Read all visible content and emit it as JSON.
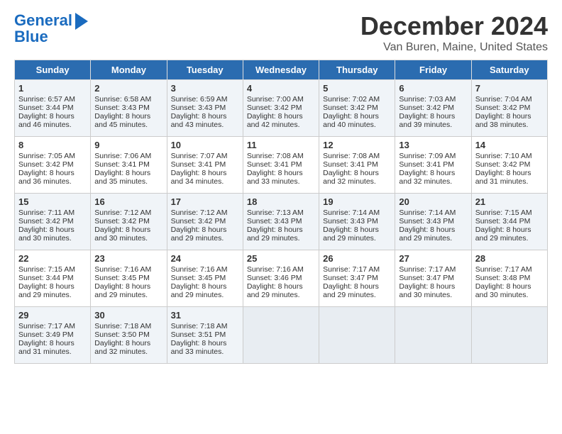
{
  "logo": {
    "line1": "General",
    "line2": "Blue"
  },
  "title": "December 2024",
  "location": "Van Buren, Maine, United States",
  "headers": [
    "Sunday",
    "Monday",
    "Tuesday",
    "Wednesday",
    "Thursday",
    "Friday",
    "Saturday"
  ],
  "weeks": [
    [
      {
        "day": "1",
        "sunrise": "Sunrise: 6:57 AM",
        "sunset": "Sunset: 3:44 PM",
        "daylight": "Daylight: 8 hours and 46 minutes."
      },
      {
        "day": "2",
        "sunrise": "Sunrise: 6:58 AM",
        "sunset": "Sunset: 3:43 PM",
        "daylight": "Daylight: 8 hours and 45 minutes."
      },
      {
        "day": "3",
        "sunrise": "Sunrise: 6:59 AM",
        "sunset": "Sunset: 3:43 PM",
        "daylight": "Daylight: 8 hours and 43 minutes."
      },
      {
        "day": "4",
        "sunrise": "Sunrise: 7:00 AM",
        "sunset": "Sunset: 3:42 PM",
        "daylight": "Daylight: 8 hours and 42 minutes."
      },
      {
        "day": "5",
        "sunrise": "Sunrise: 7:02 AM",
        "sunset": "Sunset: 3:42 PM",
        "daylight": "Daylight: 8 hours and 40 minutes."
      },
      {
        "day": "6",
        "sunrise": "Sunrise: 7:03 AM",
        "sunset": "Sunset: 3:42 PM",
        "daylight": "Daylight: 8 hours and 39 minutes."
      },
      {
        "day": "7",
        "sunrise": "Sunrise: 7:04 AM",
        "sunset": "Sunset: 3:42 PM",
        "daylight": "Daylight: 8 hours and 38 minutes."
      }
    ],
    [
      {
        "day": "8",
        "sunrise": "Sunrise: 7:05 AM",
        "sunset": "Sunset: 3:42 PM",
        "daylight": "Daylight: 8 hours and 36 minutes."
      },
      {
        "day": "9",
        "sunrise": "Sunrise: 7:06 AM",
        "sunset": "Sunset: 3:41 PM",
        "daylight": "Daylight: 8 hours and 35 minutes."
      },
      {
        "day": "10",
        "sunrise": "Sunrise: 7:07 AM",
        "sunset": "Sunset: 3:41 PM",
        "daylight": "Daylight: 8 hours and 34 minutes."
      },
      {
        "day": "11",
        "sunrise": "Sunrise: 7:08 AM",
        "sunset": "Sunset: 3:41 PM",
        "daylight": "Daylight: 8 hours and 33 minutes."
      },
      {
        "day": "12",
        "sunrise": "Sunrise: 7:08 AM",
        "sunset": "Sunset: 3:41 PM",
        "daylight": "Daylight: 8 hours and 32 minutes."
      },
      {
        "day": "13",
        "sunrise": "Sunrise: 7:09 AM",
        "sunset": "Sunset: 3:41 PM",
        "daylight": "Daylight: 8 hours and 32 minutes."
      },
      {
        "day": "14",
        "sunrise": "Sunrise: 7:10 AM",
        "sunset": "Sunset: 3:42 PM",
        "daylight": "Daylight: 8 hours and 31 minutes."
      }
    ],
    [
      {
        "day": "15",
        "sunrise": "Sunrise: 7:11 AM",
        "sunset": "Sunset: 3:42 PM",
        "daylight": "Daylight: 8 hours and 30 minutes."
      },
      {
        "day": "16",
        "sunrise": "Sunrise: 7:12 AM",
        "sunset": "Sunset: 3:42 PM",
        "daylight": "Daylight: 8 hours and 30 minutes."
      },
      {
        "day": "17",
        "sunrise": "Sunrise: 7:12 AM",
        "sunset": "Sunset: 3:42 PM",
        "daylight": "Daylight: 8 hours and 29 minutes."
      },
      {
        "day": "18",
        "sunrise": "Sunrise: 7:13 AM",
        "sunset": "Sunset: 3:43 PM",
        "daylight": "Daylight: 8 hours and 29 minutes."
      },
      {
        "day": "19",
        "sunrise": "Sunrise: 7:14 AM",
        "sunset": "Sunset: 3:43 PM",
        "daylight": "Daylight: 8 hours and 29 minutes."
      },
      {
        "day": "20",
        "sunrise": "Sunrise: 7:14 AM",
        "sunset": "Sunset: 3:43 PM",
        "daylight": "Daylight: 8 hours and 29 minutes."
      },
      {
        "day": "21",
        "sunrise": "Sunrise: 7:15 AM",
        "sunset": "Sunset: 3:44 PM",
        "daylight": "Daylight: 8 hours and 29 minutes."
      }
    ],
    [
      {
        "day": "22",
        "sunrise": "Sunrise: 7:15 AM",
        "sunset": "Sunset: 3:44 PM",
        "daylight": "Daylight: 8 hours and 29 minutes."
      },
      {
        "day": "23",
        "sunrise": "Sunrise: 7:16 AM",
        "sunset": "Sunset: 3:45 PM",
        "daylight": "Daylight: 8 hours and 29 minutes."
      },
      {
        "day": "24",
        "sunrise": "Sunrise: 7:16 AM",
        "sunset": "Sunset: 3:45 PM",
        "daylight": "Daylight: 8 hours and 29 minutes."
      },
      {
        "day": "25",
        "sunrise": "Sunrise: 7:16 AM",
        "sunset": "Sunset: 3:46 PM",
        "daylight": "Daylight: 8 hours and 29 minutes."
      },
      {
        "day": "26",
        "sunrise": "Sunrise: 7:17 AM",
        "sunset": "Sunset: 3:47 PM",
        "daylight": "Daylight: 8 hours and 29 minutes."
      },
      {
        "day": "27",
        "sunrise": "Sunrise: 7:17 AM",
        "sunset": "Sunset: 3:47 PM",
        "daylight": "Daylight: 8 hours and 30 minutes."
      },
      {
        "day": "28",
        "sunrise": "Sunrise: 7:17 AM",
        "sunset": "Sunset: 3:48 PM",
        "daylight": "Daylight: 8 hours and 30 minutes."
      }
    ],
    [
      {
        "day": "29",
        "sunrise": "Sunrise: 7:17 AM",
        "sunset": "Sunset: 3:49 PM",
        "daylight": "Daylight: 8 hours and 31 minutes."
      },
      {
        "day": "30",
        "sunrise": "Sunrise: 7:18 AM",
        "sunset": "Sunset: 3:50 PM",
        "daylight": "Daylight: 8 hours and 32 minutes."
      },
      {
        "day": "31",
        "sunrise": "Sunrise: 7:18 AM",
        "sunset": "Sunset: 3:51 PM",
        "daylight": "Daylight: 8 hours and 33 minutes."
      },
      null,
      null,
      null,
      null
    ]
  ]
}
